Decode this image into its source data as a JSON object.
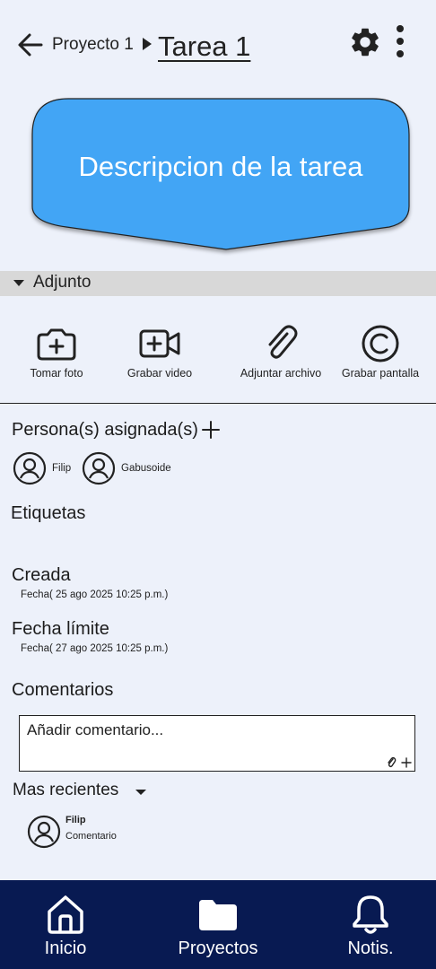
{
  "header": {
    "parent_project": "Proyecto 1",
    "task_title": "Tarea 1"
  },
  "description": {
    "text": "Descripcion de la tarea",
    "color": "#42a5f5"
  },
  "attachments": {
    "section_label": "Adjunto",
    "items": [
      {
        "label": "Tomar foto",
        "icon": "camera-plus-icon"
      },
      {
        "label": "Grabar video",
        "icon": "video-plus-icon"
      },
      {
        "label": "Adjuntar archivo",
        "icon": "paperclip-icon"
      },
      {
        "label": "Grabar pantalla",
        "icon": "screen-record-icon"
      }
    ]
  },
  "assignees": {
    "title": "Persona(s) asignada(s)",
    "people": [
      {
        "name": "Filip"
      },
      {
        "name": "Gabusoide"
      }
    ]
  },
  "tags": {
    "title": "Etiquetas"
  },
  "created": {
    "title": "Creada",
    "date": "Fecha( 25 ago 2025 10:25 p.m.)"
  },
  "deadline": {
    "title": "Fecha límite",
    "date": "Fecha( 27 ago 2025 10:25 p.m.)"
  },
  "comments": {
    "title": "Comentarios",
    "placeholder": "Añadir comentario...",
    "sort_label": "Mas recientes",
    "list": [
      {
        "author": "Filip",
        "text": "Comentario"
      }
    ]
  },
  "nav": {
    "background": "#081a52",
    "items": [
      {
        "label": "Inicio",
        "icon": "home-icon"
      },
      {
        "label": "Proyectos",
        "icon": "folder-icon"
      },
      {
        "label": "Notis.",
        "icon": "bell-icon"
      }
    ]
  }
}
